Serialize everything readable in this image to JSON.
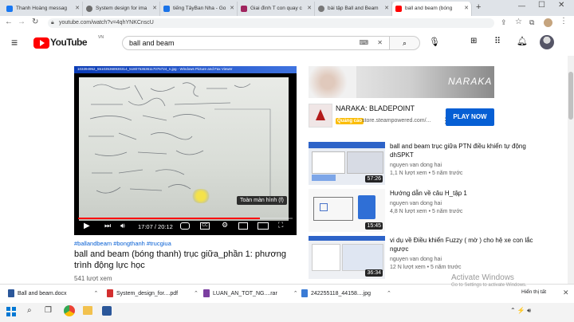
{
  "tabs": [
    {
      "label": "Thanh Hoàng messag",
      "color": "#1877f2",
      "active": false
    },
    {
      "label": "System design for ima",
      "color": "#6c6c6c",
      "active": false
    },
    {
      "label": "tiếng TâyBan Nha - Go",
      "color": "#1a73e8",
      "active": false
    },
    {
      "label": "Giai đình T con quay c",
      "color": "#a0245e",
      "active": false
    },
    {
      "label": "bài tập Ball and Beam",
      "color": "#777777",
      "active": false
    },
    {
      "label": "ball and beam (bóng",
      "color": "#ff0000",
      "active": true
    }
  ],
  "browser": {
    "url": "youtube.com/watch?v=4qhYNKCnscU"
  },
  "youtube": {
    "logo": "YouTube",
    "region": "VN",
    "search_value": "ball and beam"
  },
  "video": {
    "window_title": "103394952_551035368930314_5180753636117076724_n.jpg - Windows Picture and Fax Viewer",
    "tooltip": "Toàn màn hình (f)",
    "time": "17:07 / 20:12",
    "progress": 0.847,
    "hashtags": "#ballandbeam #bongthanh #trucgiua",
    "title": "ball and beam (bóng thanh) trục giữa_phần 1: phương trình động lực học",
    "views_partial": "541 lượt xem"
  },
  "ad": {
    "banner_text": "NARAKA",
    "title": "NARAKA: BLADEPOINT",
    "badge": "Quảng cáo",
    "domain": "store.steampowered.com/...",
    "cta": "PLAY NOW"
  },
  "recommendations": [
    {
      "title": "ball and beam trục giữa PTN điều khiển tự động dhSPKT",
      "channel": "nguyen van dong hai",
      "meta": "1,1 N lượt xem • 5 năm trước",
      "duration": "57:26"
    },
    {
      "title": "Hướng dẫn về câu H_tập 1",
      "channel": "nguyen van dong hai",
      "meta": "4,8 N lượt xem • 5 năm trước",
      "duration": "15:45"
    },
    {
      "title": "vi dụ về Điều khiển Fuzzy ( mờ ) cho hệ xe con lắc ngược",
      "channel": "nguyen van dong hai",
      "meta": "12 N lượt xem • 5 năm trước",
      "duration": "36:34"
    }
  ],
  "downloads": [
    {
      "name": "Ball and beam.docx",
      "color": "#2b579a"
    },
    {
      "name": "System_design_for....pdf",
      "color": "#d32f2f"
    },
    {
      "name": "LUAN_AN_TOT_NG....rar",
      "color": "#7b3fa0"
    },
    {
      "name": "242255118_44158....jpg",
      "color": "#3a7bd5"
    }
  ],
  "download_bar": {
    "show_all": "Hiển thị tất"
  },
  "activation": {
    "line1": "Activate Windows",
    "line2": "Go to Settings to activate Windows."
  }
}
